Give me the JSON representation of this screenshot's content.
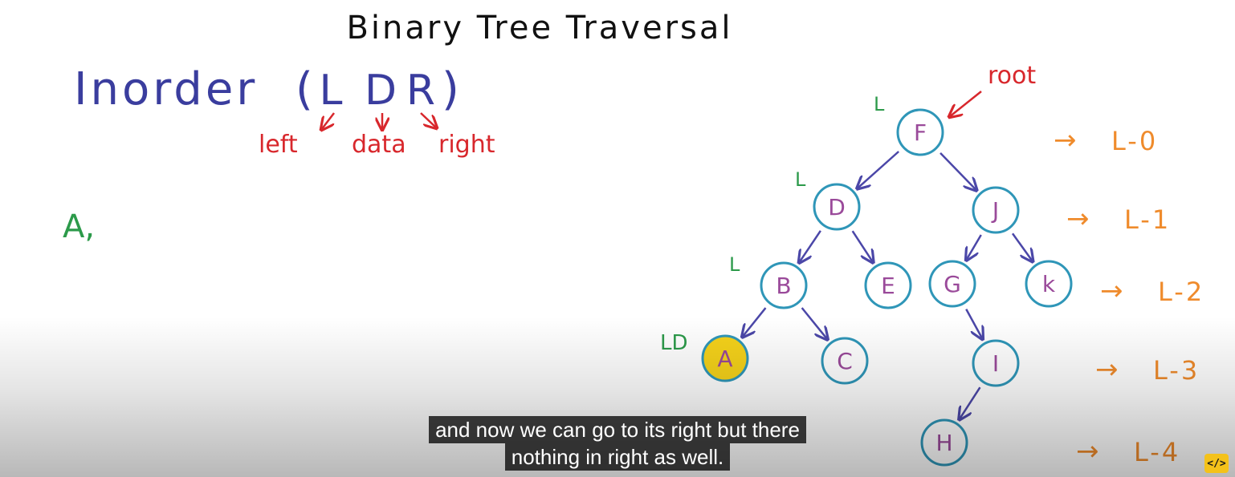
{
  "title": "Binary Tree Traversal",
  "heading": {
    "word": "Inorder",
    "paren_open": "(",
    "paren_close": ")",
    "letters": [
      "L",
      "D",
      "R"
    ],
    "labels": [
      "left",
      "data",
      "right"
    ]
  },
  "output_text": "A,",
  "root_label": "root",
  "marks": {
    "f": "L",
    "d": "L",
    "b": "L",
    "a": "LD"
  },
  "nodes": [
    {
      "id": "F",
      "label": "F"
    },
    {
      "id": "D",
      "label": "D"
    },
    {
      "id": "J",
      "label": "J"
    },
    {
      "id": "B",
      "label": "B"
    },
    {
      "id": "E",
      "label": "E"
    },
    {
      "id": "G",
      "label": "G"
    },
    {
      "id": "K",
      "label": "k"
    },
    {
      "id": "A",
      "label": "A",
      "highlighted": true
    },
    {
      "id": "C",
      "label": "C"
    },
    {
      "id": "I",
      "label": "I"
    },
    {
      "id": "H",
      "label": "H"
    }
  ],
  "edges": [
    [
      "F",
      "D"
    ],
    [
      "F",
      "J"
    ],
    [
      "D",
      "B"
    ],
    [
      "D",
      "E"
    ],
    [
      "J",
      "G"
    ],
    [
      "J",
      "K"
    ],
    [
      "B",
      "A"
    ],
    [
      "B",
      "C"
    ],
    [
      "G",
      "I"
    ],
    [
      "I",
      "H"
    ]
  ],
  "levels": [
    {
      "arrow": "→",
      "label": "L-0"
    },
    {
      "arrow": "→",
      "label": "L-1"
    },
    {
      "arrow": "→",
      "label": "L-2"
    },
    {
      "arrow": "→",
      "label": "L-3"
    },
    {
      "arrow": "→",
      "label": "L-4"
    }
  ],
  "subtitle": {
    "line1": "and now we can go to its right but there",
    "line2": "nothing in right as well."
  },
  "badge_text": "</>",
  "colors": {
    "title": "#111111",
    "heading": "#3a3d9e",
    "red": "#d8272c",
    "green": "#2c9a4a",
    "node_border": "#2f96b8",
    "node_text": "#9a4a9a",
    "edge": "#4b47a8",
    "level": "#ef8b2c",
    "highlight": "#f5d21a"
  }
}
